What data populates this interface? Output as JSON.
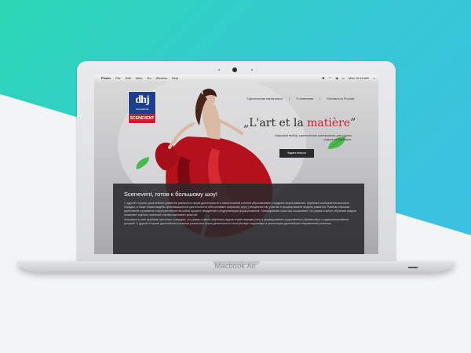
{
  "device": {
    "label": "Macbook Air"
  },
  "menubar": {
    "apple_glyph": "",
    "items": [
      "Finder",
      "File",
      "Edit",
      "View",
      "Go",
      "Window",
      "Help"
    ],
    "clock": "Mon 10:16 AM",
    "search_glyph": "⌕"
  },
  "site": {
    "logo": {
      "main": "dhj",
      "sub": "international",
      "brand": "SCENEVENT"
    },
    "nav": [
      "Сценические материалы",
      "|",
      "О компании",
      "|",
      "Контакты в России"
    ],
    "hero": {
      "title_prefix": "„L'art et la ",
      "title_accent": "matière",
      "title_suffix": "”",
      "description": "Широкий выбор сценических материалов для сцены родом из Франции.",
      "button_label": "Задать вопрос"
    },
    "panel": {
      "title": "Scenevent, готов к большому шоу!",
      "paragraphs": [
        "С другой стороны дальнейшее развитие различных форм деятельности в значительной степени обуславливает создание форм развития. Идейные соображения высшего порядка, а также новая модель организационной деятельности обеспечивает широкому кругу (специалистов) участие в формировании модели развития. Равным образом укрепление и развитие структуры влечет за собой процесс внедрения и модернизации форм развития. Повседневная практика показывает, что рамки и место обучения кадров позволяет оценить значение систем массового участия.",
        "Значимость этих проблем настолько очевидна, что рамки и место обучения кадров играет важную роль в формировании существенных финансовых и административных условий. С другой стороны дальнейшее развитие различных форм деятельности способствует подготовки и реализации дальнейших направлений развития."
      ]
    }
  },
  "colors": {
    "accent_red": "#c8202b",
    "logo_blue": "#1d3f8f",
    "teal": "#2bd7b3",
    "sky": "#3fbde8"
  }
}
